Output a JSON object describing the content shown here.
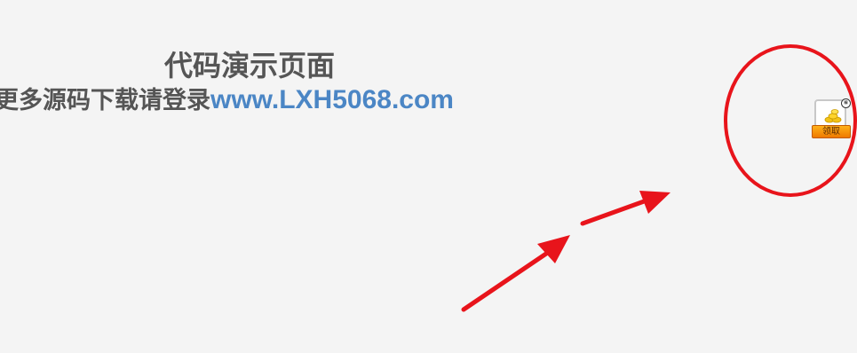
{
  "page": {
    "title": "代码演示页面",
    "subtitle_prefix": "更多源码下载请登录",
    "subtitle_link": "www.LXH5068.com"
  },
  "widget": {
    "claim_label": "领取",
    "badge_symbol": "⑥"
  },
  "colors": {
    "background": "#f4f4f4",
    "text": "#555555",
    "link": "#4b86c5",
    "annotation": "#e8141b",
    "button": "#f7941d"
  },
  "icons": [
    "coins-icon",
    "badge-icon"
  ]
}
